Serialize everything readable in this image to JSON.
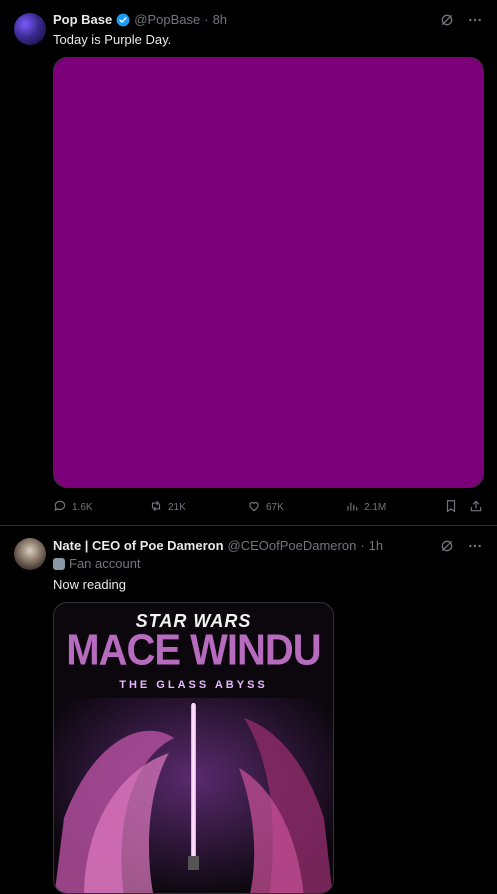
{
  "tweets": [
    {
      "name": "Pop Base",
      "handle": "@PopBase",
      "time": "8h",
      "text": "Today is Purple Day.",
      "media_color": "#7b0079",
      "actions": {
        "replies": "1.6K",
        "reposts": "21K",
        "likes": "67K",
        "views": "2.1M"
      }
    },
    {
      "name": "Nate | CEO of Poe Dameron",
      "handle": "@CEOofPoeDameron",
      "time": "1h",
      "label": "Fan account",
      "text": "Now reading",
      "poster": {
        "logo": "STAR WARS",
        "title": "MACE WINDU",
        "subtitle": "THE GLASS ABYSS"
      }
    }
  ],
  "colors": {
    "background": "#000000",
    "verified": "#1d9bf0",
    "muted": "#71767b",
    "divider": "#2f3336"
  },
  "icons": [
    "verified-badge-icon",
    "grok-icon",
    "more-icon",
    "reply-icon",
    "repost-icon",
    "like-icon",
    "views-icon",
    "bookmark-icon",
    "share-icon"
  ]
}
